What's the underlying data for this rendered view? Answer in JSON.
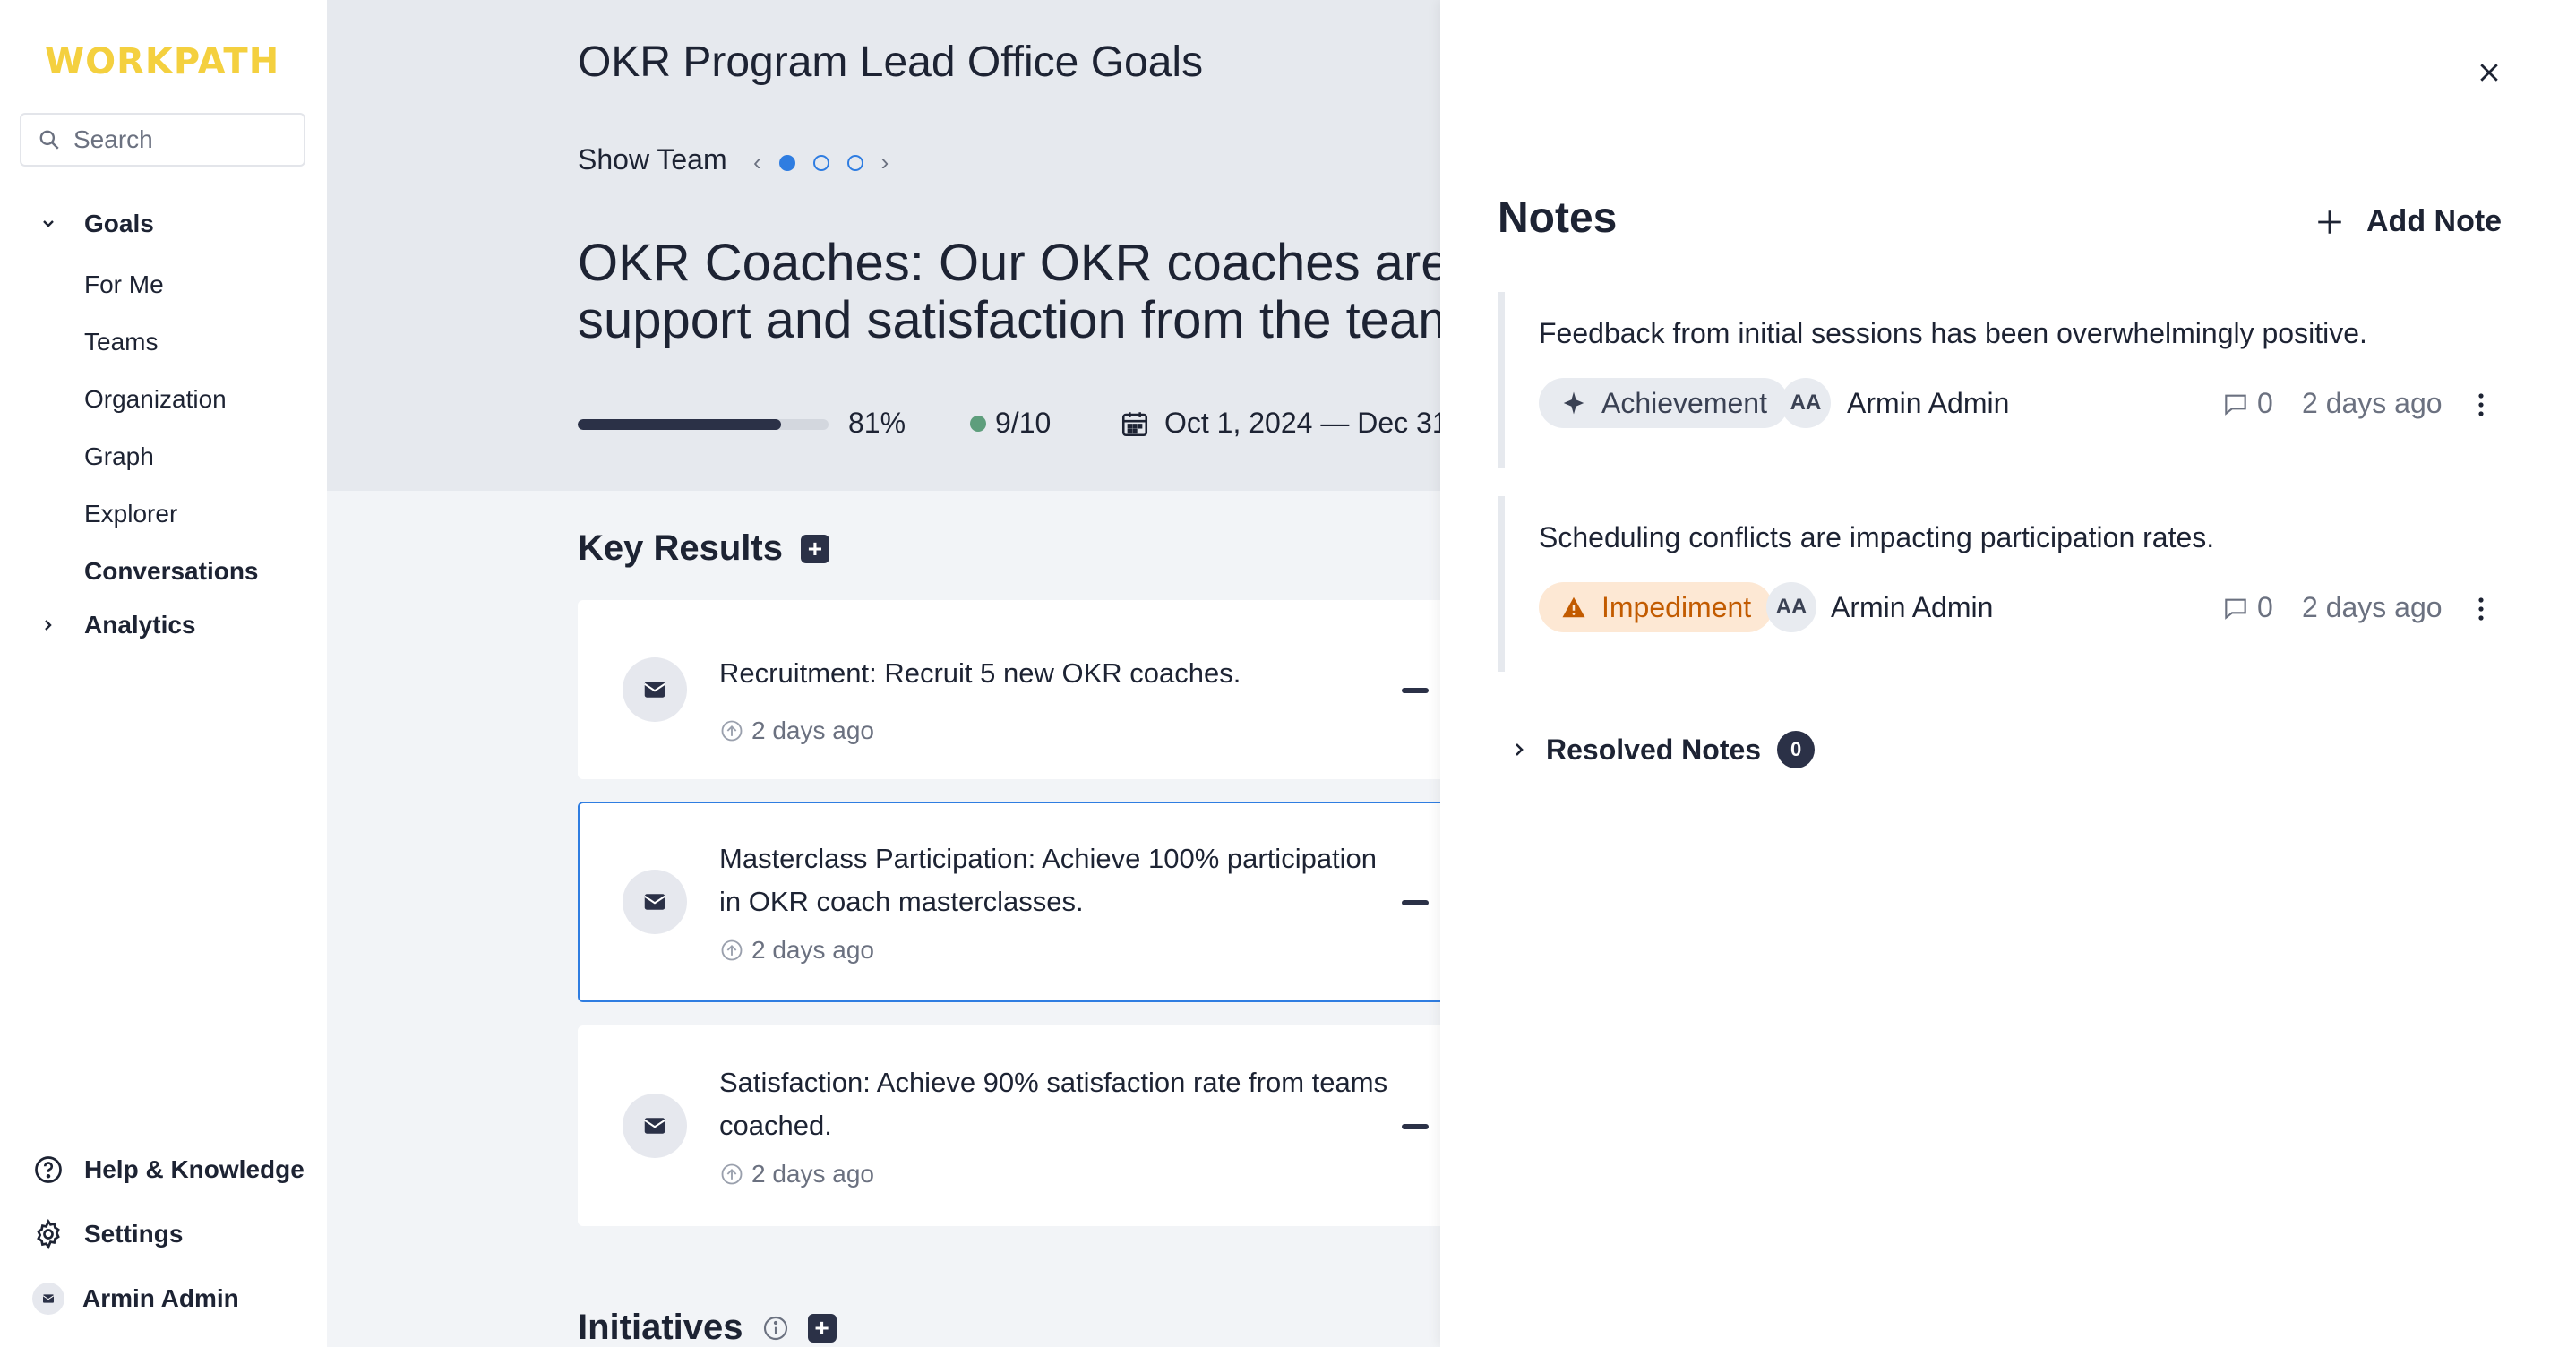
{
  "brand": {
    "logo": "WORKPATH",
    "logo_color": "#f4d03f",
    "accent": "#2f7de1"
  },
  "sidebar": {
    "search_placeholder": "Search",
    "goals_label": "Goals",
    "goals_items": [
      "For Me",
      "Teams",
      "Organization",
      "Graph",
      "Explorer"
    ],
    "conversations_label": "Conversations",
    "analytics_label": "Analytics",
    "help_label": "Help & Knowledge",
    "settings_label": "Settings",
    "user_label": "Armin Admin"
  },
  "goal": {
    "title": "OKR Program Lead Office Goals",
    "show_team": "Show Team",
    "pager": {
      "pages": 3,
      "active": 1
    },
    "objective_line1": "OKR Coaches: Our OKR coaches are en",
    "objective_line2": "support and satisfaction from the teams",
    "progress": 0.81,
    "progress_label": "81%",
    "confidence": "9/10",
    "date_range": "Oct 1, 2024 — Dec 31"
  },
  "key_results": {
    "heading": "Key Results",
    "items": [
      {
        "title": "Recruitment: Recruit 5 new OKR coaches.",
        "updated": "2 days ago",
        "selected": false
      },
      {
        "title": "Masterclass Participation: Achieve 100% participation in OKR coach masterclasses.",
        "updated": "2 days ago",
        "selected": true
      },
      {
        "title": "Satisfaction: Achieve 90% satisfaction rate from teams coached.",
        "updated": "2 days ago",
        "selected": false
      }
    ]
  },
  "initiatives": {
    "heading": "Initiatives"
  },
  "notes": {
    "title": "Notes",
    "add_label": "Add Note",
    "items": [
      {
        "text": "Feedback from initial sessions has been overwhelmingly positive.",
        "tag": "Achievement",
        "tag_type": "achievement",
        "initials": "AA",
        "author": "Armin Admin",
        "comments": "0",
        "ago": "2 days ago"
      },
      {
        "text": "Scheduling conflicts are impacting participation rates.",
        "tag": "Impediment",
        "tag_type": "impediment",
        "initials": "AA",
        "author": "Armin Admin",
        "comments": "0",
        "ago": "2 days ago"
      }
    ],
    "resolved_label": "Resolved Notes",
    "resolved_count": "0"
  }
}
